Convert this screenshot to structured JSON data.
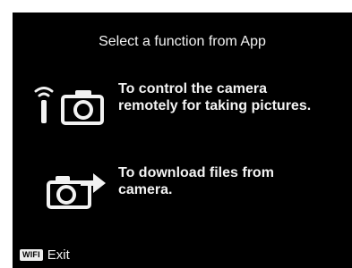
{
  "screen": {
    "title": "Select a function from App",
    "options": [
      {
        "icon": "remote-camera-icon",
        "line1": "To control the camera",
        "line2": "remotely for taking pictures."
      },
      {
        "icon": "camera-transfer-icon",
        "line1": "To download files from",
        "line2": "camera."
      }
    ],
    "footer": {
      "key_label": "WIFI",
      "action_label": "Exit"
    }
  },
  "colors": {
    "background": "#000000",
    "text": "#f2f2f2",
    "key_badge": "#ededed"
  }
}
